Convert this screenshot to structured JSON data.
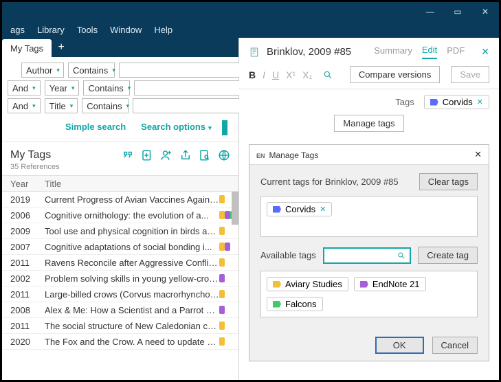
{
  "window": {
    "minimize": "—",
    "maximize": "▭",
    "close": "✕"
  },
  "menu": [
    "ags",
    "Library",
    "Tools",
    "Window",
    "Help"
  ],
  "tab": {
    "label": "My Tags"
  },
  "search": {
    "rows": [
      {
        "and": "",
        "field": "Author",
        "op": "Contains"
      },
      {
        "and": "And",
        "field": "Year",
        "op": "Contains"
      },
      {
        "and": "And",
        "field": "Title",
        "op": "Contains"
      }
    ],
    "simple": "Simple search",
    "options": "Search options"
  },
  "group": {
    "title": "My Tags",
    "sub": "35 References"
  },
  "columns": {
    "year": "Year",
    "title": "Title"
  },
  "rows": [
    {
      "year": "2019",
      "title": "Current Progress of Avian Vaccines Against ...",
      "tags": [
        "y"
      ]
    },
    {
      "year": "2006",
      "title": "Cognitive ornithology: the evolution of a...",
      "tags": [
        "y",
        "p",
        "g"
      ]
    },
    {
      "year": "2009",
      "title": "Tool use and physical cognition in birds and...",
      "tags": [
        "y"
      ]
    },
    {
      "year": "2007",
      "title": "Cognitive adaptations of social bonding i...",
      "tags": [
        "y",
        "p"
      ]
    },
    {
      "year": "2011",
      "title": "Ravens Reconcile after Aggressive Conflicts ...",
      "tags": [
        "y"
      ]
    },
    {
      "year": "2002",
      "title": "Problem solving skills in young yellow-crow...",
      "tags": [
        "p"
      ]
    },
    {
      "year": "2011",
      "title": "Large-billed crows (Corvus macrorhynchos) ...",
      "tags": [
        "y"
      ]
    },
    {
      "year": "2008",
      "title": "Alex & Me: How a Scientist and a Parrot Dis...",
      "tags": [
        "p"
      ]
    },
    {
      "year": "2011",
      "title": "The social structure of New Caledonian crows",
      "tags": [
        "y"
      ]
    },
    {
      "year": "2020",
      "title": "The Fox and the Crow. A need to update pe...",
      "tags": [
        "y"
      ]
    }
  ],
  "ref": {
    "title": "Brinklov, 2009 #85",
    "tabs": {
      "summary": "Summary",
      "edit": "Edit",
      "pdf": "PDF"
    },
    "toolbar": {
      "compare": "Compare versions",
      "save": "Save"
    },
    "tags_label": "Tags",
    "current_tag": "Corvids",
    "manage": "Manage tags"
  },
  "dialog": {
    "title": "Manage Tags",
    "subtitle": "Current tags for Brinklov, 2009 #85",
    "clear": "Clear tags",
    "current": [
      "Corvids"
    ],
    "avail_label": "Available tags",
    "create": "Create tag",
    "available": [
      {
        "label": "Aviary Studies",
        "color": "y"
      },
      {
        "label": "EndNote 21",
        "color": "p"
      },
      {
        "label": "Falcons",
        "color": "g"
      }
    ],
    "ok": "OK",
    "cancel": "Cancel"
  }
}
